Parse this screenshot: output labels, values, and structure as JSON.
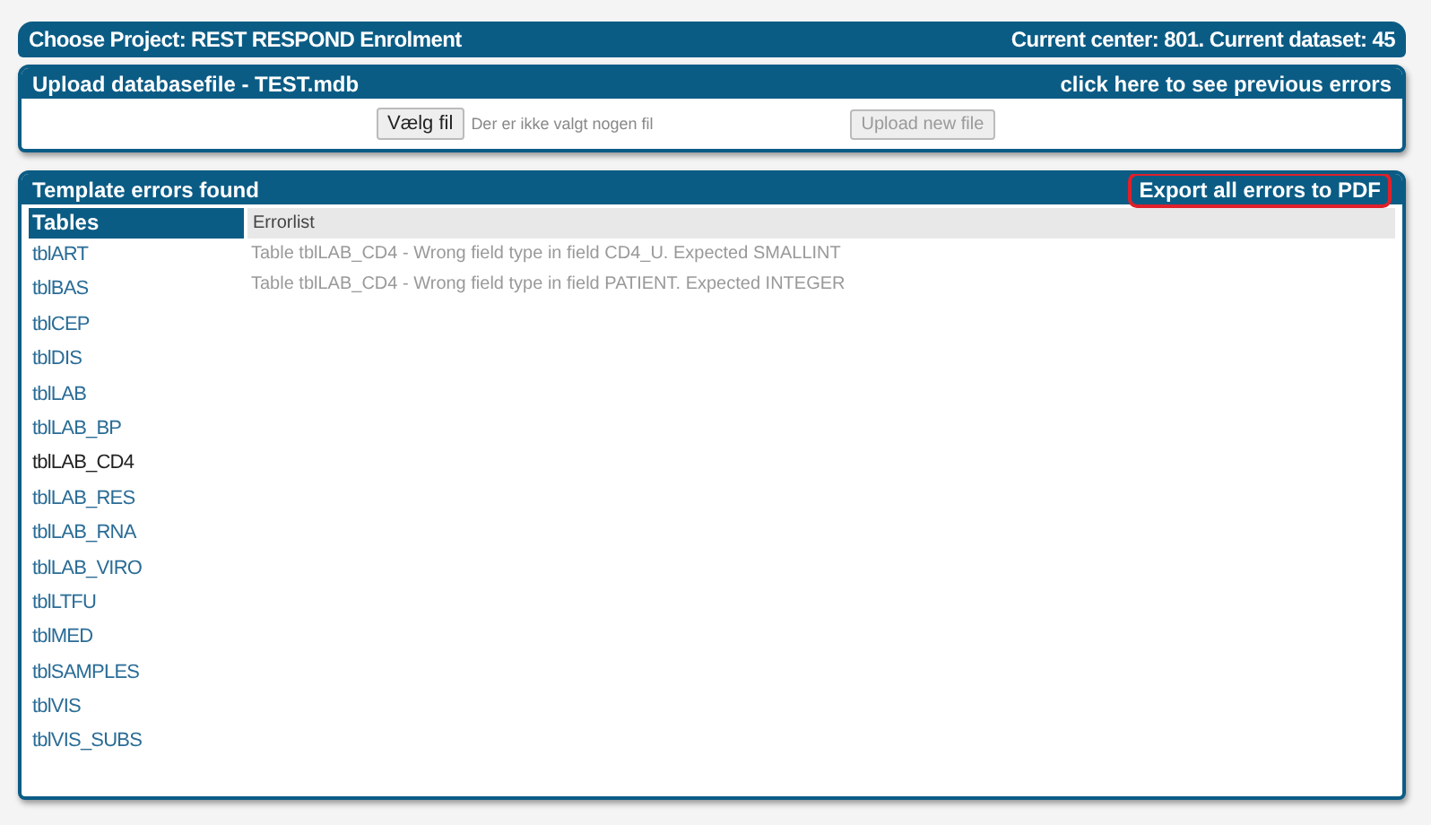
{
  "project_bar": {
    "title": "Choose Project: REST RESPOND Enrolment",
    "status": "Current center: 801. Current dataset: 45"
  },
  "upload": {
    "title": "Upload databasefile  - TEST.mdb",
    "previous_errors_link": "click here to see previous errors",
    "choose_button": "Vælg fil",
    "file_status": "Der er ikke valgt nogen fil",
    "upload_button": {
      "label": "Upload new file",
      "disabled": true
    }
  },
  "errors": {
    "title": "Template errors found",
    "export_link": {
      "label": "Export all errors to PDF",
      "highlighted": true
    },
    "tables_header": "Tables",
    "errorlist_header": "Errorlist",
    "tables": [
      {
        "name": "tblART",
        "selected": false
      },
      {
        "name": "tblBAS",
        "selected": false
      },
      {
        "name": "tblCEP",
        "selected": false
      },
      {
        "name": "tblDIS",
        "selected": false
      },
      {
        "name": "tblLAB",
        "selected": false
      },
      {
        "name": "tblLAB_BP",
        "selected": false
      },
      {
        "name": "tblLAB_CD4",
        "selected": true
      },
      {
        "name": "tblLAB_RES",
        "selected": false
      },
      {
        "name": "tblLAB_RNA",
        "selected": false
      },
      {
        "name": "tblLAB_VIRO",
        "selected": false
      },
      {
        "name": "tblLTFU",
        "selected": false
      },
      {
        "name": "tblMED",
        "selected": false
      },
      {
        "name": "tblSAMPLES",
        "selected": false
      },
      {
        "name": "tblVIS",
        "selected": false
      },
      {
        "name": "tblVIS_SUBS",
        "selected": false
      }
    ],
    "error_rows": [
      "Table tblLAB_CD4 - Wrong field type in field CD4_U. Expected SMALLINT",
      "Table tblLAB_CD4 - Wrong field type in field PATIENT. Expected INTEGER"
    ]
  }
}
